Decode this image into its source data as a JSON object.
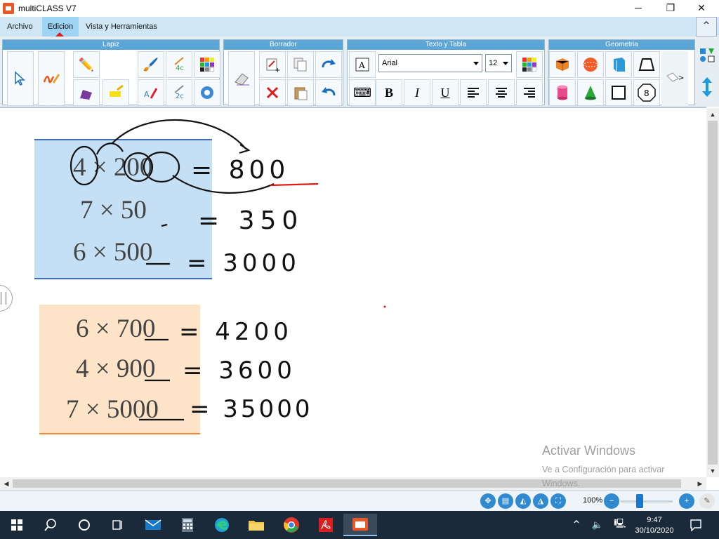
{
  "window": {
    "title": "multiCLASS V7",
    "minimize_glyph": "─",
    "maximize_glyph": "❐",
    "close_glyph": "✕"
  },
  "menu": {
    "items": [
      "Archivo",
      "Edicion",
      "Vista y Herramientas"
    ],
    "active": "Edicion"
  },
  "ribbon": {
    "groups": [
      "Lapiz",
      "Borrador",
      "Texto y Tabla",
      "Geometria"
    ],
    "font_name": "Arial",
    "font_size": "12",
    "bold": "B",
    "italic": "I",
    "underline": "U"
  },
  "worksheet": {
    "blue_box": [
      {
        "expr": "4 × 200",
        "handwritten": "= 800"
      },
      {
        "expr": "7 × 50",
        "handwritten": "= 350"
      },
      {
        "expr": "6 × 500",
        "handwritten": "= 3000"
      }
    ],
    "orange_box": [
      {
        "expr": "6 × 700",
        "handwritten": "= 4200"
      },
      {
        "expr": "4 × 900",
        "handwritten": "= 3600"
      },
      {
        "expr": "7 × 5000",
        "handwritten": "= 35000"
      }
    ]
  },
  "watermark": {
    "title": "Activar Windows",
    "subtitle": "Ve a Configuración para activar Windows."
  },
  "statusbar": {
    "zoom": "100%"
  },
  "taskbar": {
    "time": "9:47",
    "date": "30/10/2020"
  },
  "colors": {
    "blue_box": "#c5e0f5",
    "blue_box_border": "#3f6fb0",
    "orange_box": "#fde4c8",
    "orange_box_border": "#f08a3a",
    "ink": "#111111",
    "red_ink": "#e01818",
    "ribbon_head": "#5ba6d6"
  }
}
